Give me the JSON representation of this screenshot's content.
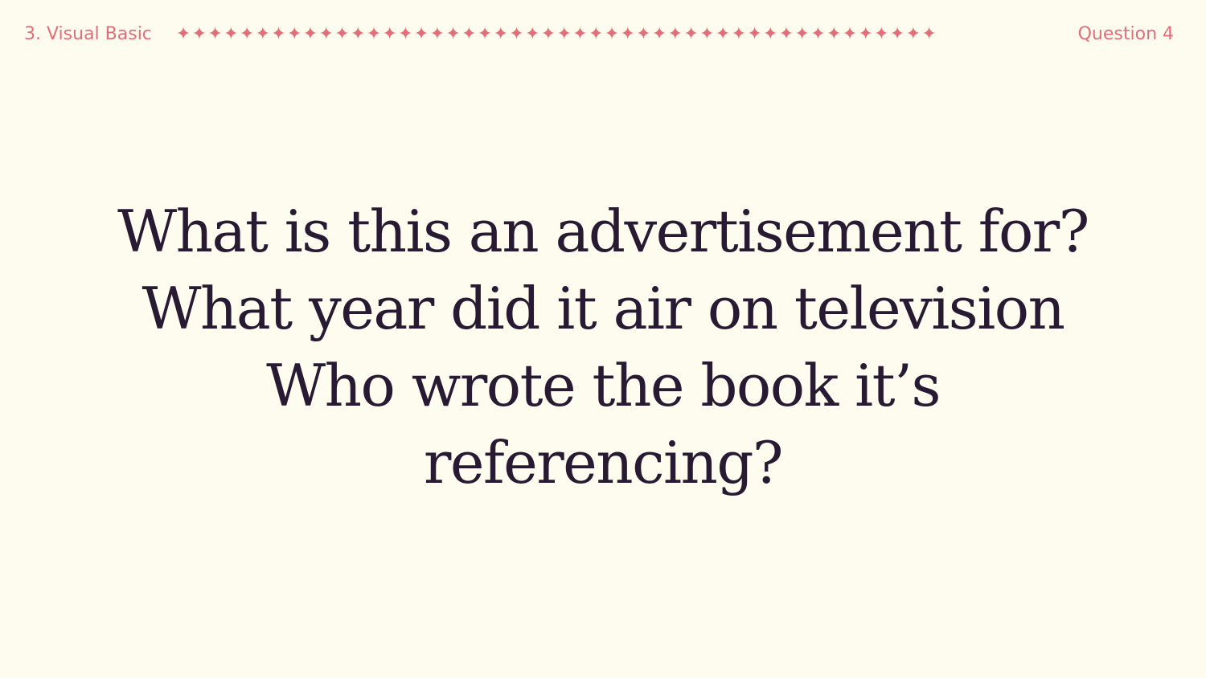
{
  "header": {
    "section_label": "3. Visual Basic",
    "question_label": "Question 4",
    "divider_stars": "✦✦✦✦✦✦✦✦✦✦✦✦✦✦✦✦✦✦✦✦✦✦✦✦✦✦✦✦✦✦✦✦✦✦✦✦✦✦✦✦✦✦✦✦✦✦✦✦"
  },
  "question": {
    "lines": [
      "What is this an advertisement for?",
      "What year did it air on television",
      "Who wrote the book it’s",
      "referencing?"
    ]
  },
  "colors": {
    "background": "#fefbef",
    "accent": "#e16f7a",
    "text": "#281a33"
  }
}
